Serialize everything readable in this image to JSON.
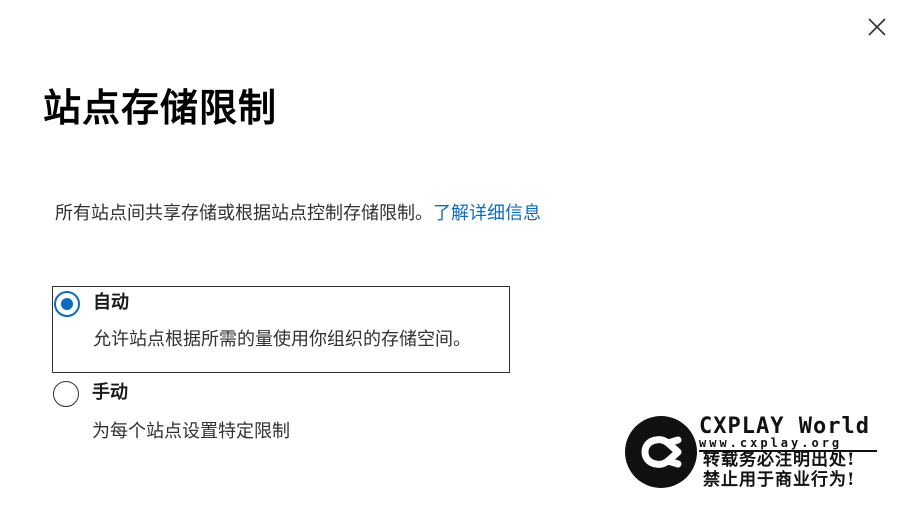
{
  "dialog": {
    "title": "站点存储限制",
    "description": "所有站点间共享存储或根据站点控制存储限制。",
    "learn_more_link": "了解详细信息",
    "close_icon": "close-icon"
  },
  "options": [
    {
      "label": "自动",
      "description": "允许站点根据所需的量使用你组织的存储空间。",
      "selected": true
    },
    {
      "label": "手动",
      "description": "为每个站点设置特定限制",
      "selected": false
    }
  ],
  "watermark": {
    "brand": "CXPLAY World",
    "url": "www.cxplay.org",
    "line1": "转载务必注明出处!",
    "line2": "禁止用于商业行为!"
  },
  "colors": {
    "accent": "#0f6cbd",
    "text": "#1b1a19",
    "border": "#323130"
  }
}
